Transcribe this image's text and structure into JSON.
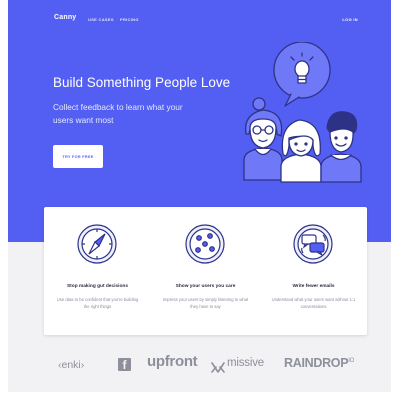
{
  "nav": {
    "logo": "Canny",
    "links": [
      "USE CASES",
      "PRICING"
    ],
    "login": "LOG IN"
  },
  "hero": {
    "title": "Build Something People Love",
    "subtitle": "Collect feedback to learn what your users want most",
    "cta": "TRY FOR FREE"
  },
  "features": [
    {
      "icon": "compass-icon",
      "title": "Stop making gut decisions",
      "desc": "Use data to be confident that you're building the right things"
    },
    {
      "icon": "users-circle-icon",
      "title": "Show your users you care",
      "desc": "Impress your users by simply listening to what they have to say"
    },
    {
      "icon": "chat-bubbles-icon",
      "title": "Write fewer emails",
      "desc": "Understand what your users want without 1:1 conversations"
    }
  ],
  "logos": [
    "enki",
    "f",
    "upfront",
    "missive",
    "RAINDROP",
    "IO"
  ],
  "colors": {
    "hero_bg": "#535ef2",
    "page_bg": "#f2f2f4",
    "card_bg": "#ffffff",
    "illustration_fill": "#6f78f6",
    "illustration_stroke": "#2e3287",
    "logo_gray": "#8d909b"
  }
}
